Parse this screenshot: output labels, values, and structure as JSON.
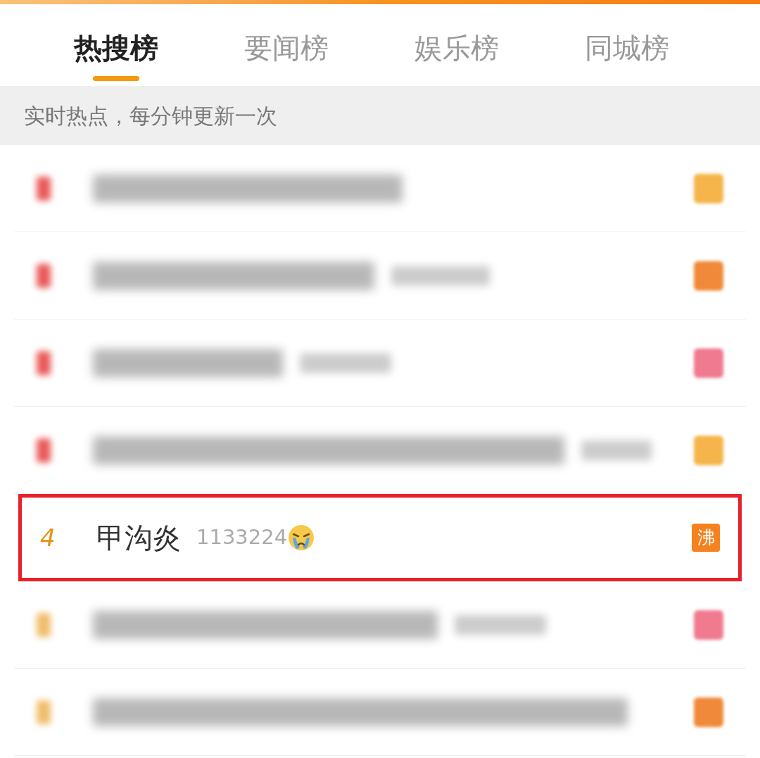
{
  "tabs": [
    {
      "label": "热搜榜",
      "selected": true
    },
    {
      "label": "要闻榜",
      "selected": false
    },
    {
      "label": "娱乐榜",
      "selected": false
    },
    {
      "label": "同城榜",
      "selected": false
    }
  ],
  "notice": "实时热点，每分钟更新一次",
  "rows": [
    {
      "kind": "blurred",
      "color": "#f5b54a",
      "highlighted": false
    },
    {
      "kind": "blurred",
      "color": "#f08a3a",
      "highlighted": false
    },
    {
      "kind": "blurred",
      "color": "#f07a90",
      "highlighted": false
    },
    {
      "kind": "blurred",
      "color": "#f5b54a",
      "highlighted": false
    },
    {
      "kind": "entry",
      "rank": "4",
      "title": "甲沟炎",
      "count": "1133224",
      "badge": "沸",
      "color": "#f5811f",
      "highlighted": true
    },
    {
      "kind": "blurred",
      "color": "#f07a90",
      "highlighted": false
    },
    {
      "kind": "blurred",
      "color": "#f08a3a",
      "highlighted": false
    }
  ]
}
